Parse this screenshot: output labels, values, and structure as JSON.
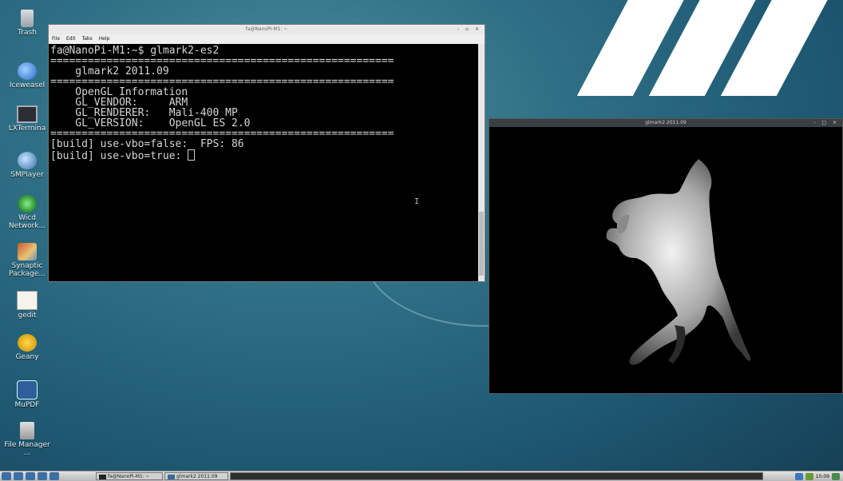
{
  "desktop": {
    "icons": [
      {
        "label": "Trash",
        "icon": "trash-icon"
      },
      {
        "label": "Iceweasel",
        "icon": "iceweasel-icon"
      },
      {
        "label": "LXTermina",
        "icon": "terminal-icon"
      },
      {
        "label": "SMPlayer",
        "icon": "smplayer-icon"
      },
      {
        "label": "Wicd Network...",
        "icon": "wicd-network-icon"
      },
      {
        "label": "Synaptic Package...",
        "icon": "synaptic-icon"
      },
      {
        "label": "gedit",
        "icon": "gedit-icon"
      },
      {
        "label": "Geany",
        "icon": "geany-icon"
      },
      {
        "label": "MuPDF",
        "icon": "mupdf-icon"
      },
      {
        "label": "File Manager ...",
        "icon": "file-manager-icon"
      }
    ]
  },
  "terminal": {
    "title": "fa@NanoPi-M1: ~",
    "menu": [
      "File",
      "Edit",
      "Tabs",
      "Help"
    ],
    "lines": [
      "fa@NanoPi-M1:~$ glmark2-es2",
      "=======================================================",
      "    glmark2 2011.09",
      "=======================================================",
      "    OpenGL Information",
      "    GL_VENDOR:     ARM",
      "    GL_RENDERER:   Mali-400 MP",
      "    GL_VERSION:    OpenGL ES 2.0",
      "=======================================================",
      "[build] use-vbo=false:  FPS: 86",
      "[build] use-vbo=true: "
    ],
    "ibeam": "I"
  },
  "glmark_window": {
    "title": "glmark2 2011.09",
    "controls": "- □ ×"
  },
  "taskbar": {
    "tasks": [
      {
        "label": "fa@NanoPi-M1: ~"
      },
      {
        "label": "glmark2 2011.09"
      }
    ],
    "clock": "10:09"
  },
  "colors": {
    "desktop_bg": "#2f6f85",
    "terminal_bg": "#000000",
    "terminal_fg": "#d6d6d6"
  }
}
